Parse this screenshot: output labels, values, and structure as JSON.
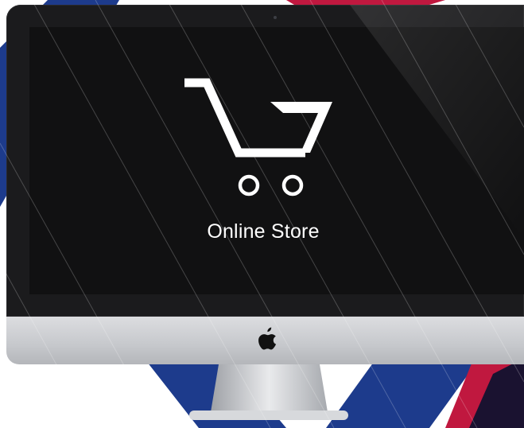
{
  "screen": {
    "label": "Online Store",
    "icon": "shopping-cart-icon"
  },
  "device": {
    "logo_icon": "apple-logo-icon"
  },
  "colors": {
    "navy": "#1d3b8c",
    "crimson": "#c0183f",
    "screen": "#111112",
    "bezel": "#1b1b1d",
    "aluminum": "#cfd1d4",
    "icon": "#ffffff"
  }
}
